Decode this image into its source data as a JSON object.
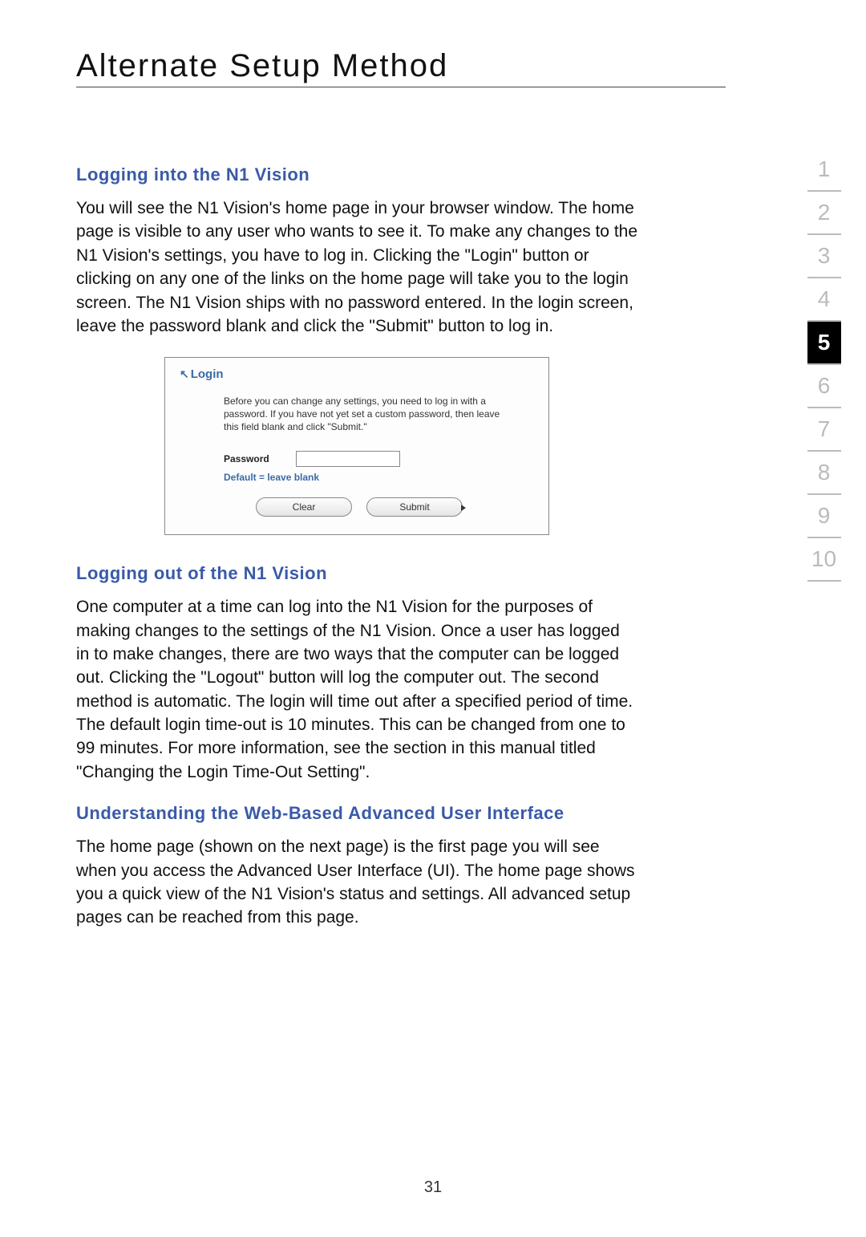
{
  "page_title": "Alternate Setup Method",
  "page_number": "31",
  "section_nav": {
    "label": "section",
    "items": [
      "1",
      "2",
      "3",
      "4",
      "5",
      "6",
      "7",
      "8",
      "9",
      "10"
    ],
    "active_index": 4
  },
  "sections": {
    "login_in": {
      "heading": "Logging into the N1 Vision",
      "body": "You will see the N1 Vision's home page in your browser window. The home page is visible to any user who wants to see it. To make any changes to the N1 Vision's settings, you have to log in. Clicking the \"Login\" button or clicking on any one of the links on the home page will take you to the login screen. The N1 Vision ships with no password entered. In the login screen, leave the password blank and click the \"Submit\" button to log in."
    },
    "login_out": {
      "heading": "Logging out of the N1 Vision",
      "body": "One computer at a time can log into the N1 Vision for the purposes of making changes to the settings of the N1 Vision. Once a user has logged in to make changes, there are two ways that the computer can be logged out. Clicking the \"Logout\" button will log the computer out. The second method is automatic. The login will time out after a specified period of time. The default login time-out is 10 minutes. This can be changed from one to 99 minutes. For more information, see the section in this manual titled \"Changing the Login Time-Out Setting\"."
    },
    "understanding": {
      "heading": "Understanding the Web-Based Advanced User Interface",
      "body": "The home page (shown on the next page) is the first page you will see when you access the Advanced User Interface (UI). The home page shows you a quick view of the N1 Vision's status and settings. All advanced setup pages can be reached from this page."
    }
  },
  "login_figure": {
    "title": "Login",
    "instructions": "Before you can change any settings, you need to log in with a password. If you have not yet set a custom password, then leave this field blank and click \"Submit.\"",
    "password_label": "Password",
    "password_value": "",
    "default_hint": "Default = leave blank",
    "clear_label": "Clear",
    "submit_label": "Submit"
  }
}
